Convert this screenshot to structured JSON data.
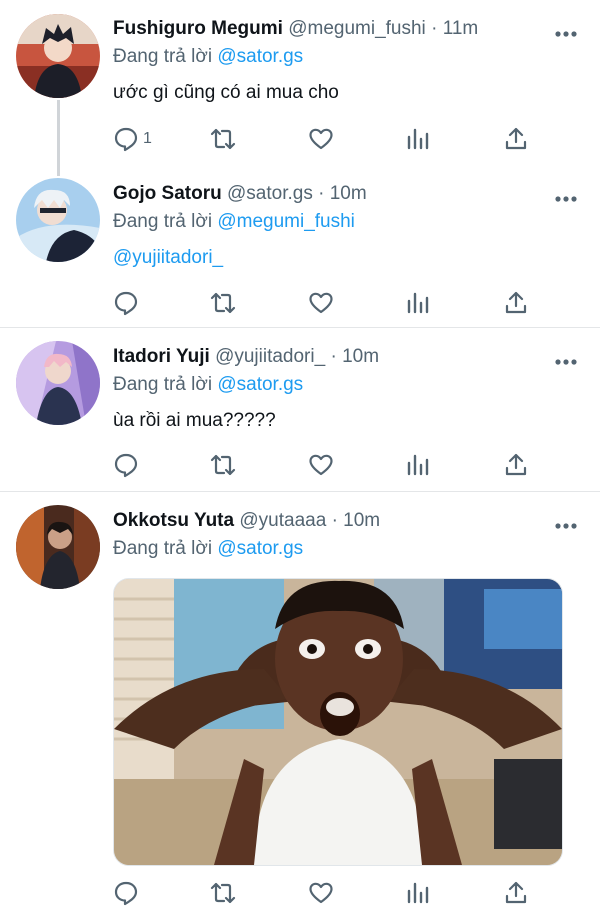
{
  "tweets": [
    {
      "display_name": "Fushiguro Megumi",
      "handle": "@megumi_fushi",
      "time": "11m",
      "reply_prefix": "Đang trả lời",
      "reply_to": "@sator.gs",
      "text": "ước gì cũng có ai mua cho",
      "reply_count": "1"
    },
    {
      "display_name": "Gojo Satoru",
      "handle": "@sator.gs",
      "time": "10m",
      "reply_prefix": "Đang trả lời",
      "reply_to": "@megumi_fushi",
      "text": "@yujiitadori_"
    },
    {
      "display_name": "Itadori Yuji",
      "handle": "@yujiitadori_",
      "time": "10m",
      "reply_prefix": "Đang trả lời",
      "reply_to": "@sator.gs",
      "text": "ùa rồi ai mua?????"
    },
    {
      "display_name": "Okkotsu Yuta",
      "handle": "@yutaaaa",
      "time": "10m",
      "reply_prefix": "Đang trả lời",
      "reply_to": "@sator.gs"
    }
  ],
  "separator": "·",
  "colors": {
    "link": "#1d9bf0",
    "muted": "#536471",
    "text": "#0f1419",
    "divider": "#e4e6e8"
  },
  "icons": [
    "reply-icon",
    "retweet-icon",
    "like-icon",
    "analytics-icon",
    "share-icon",
    "more-icon"
  ]
}
